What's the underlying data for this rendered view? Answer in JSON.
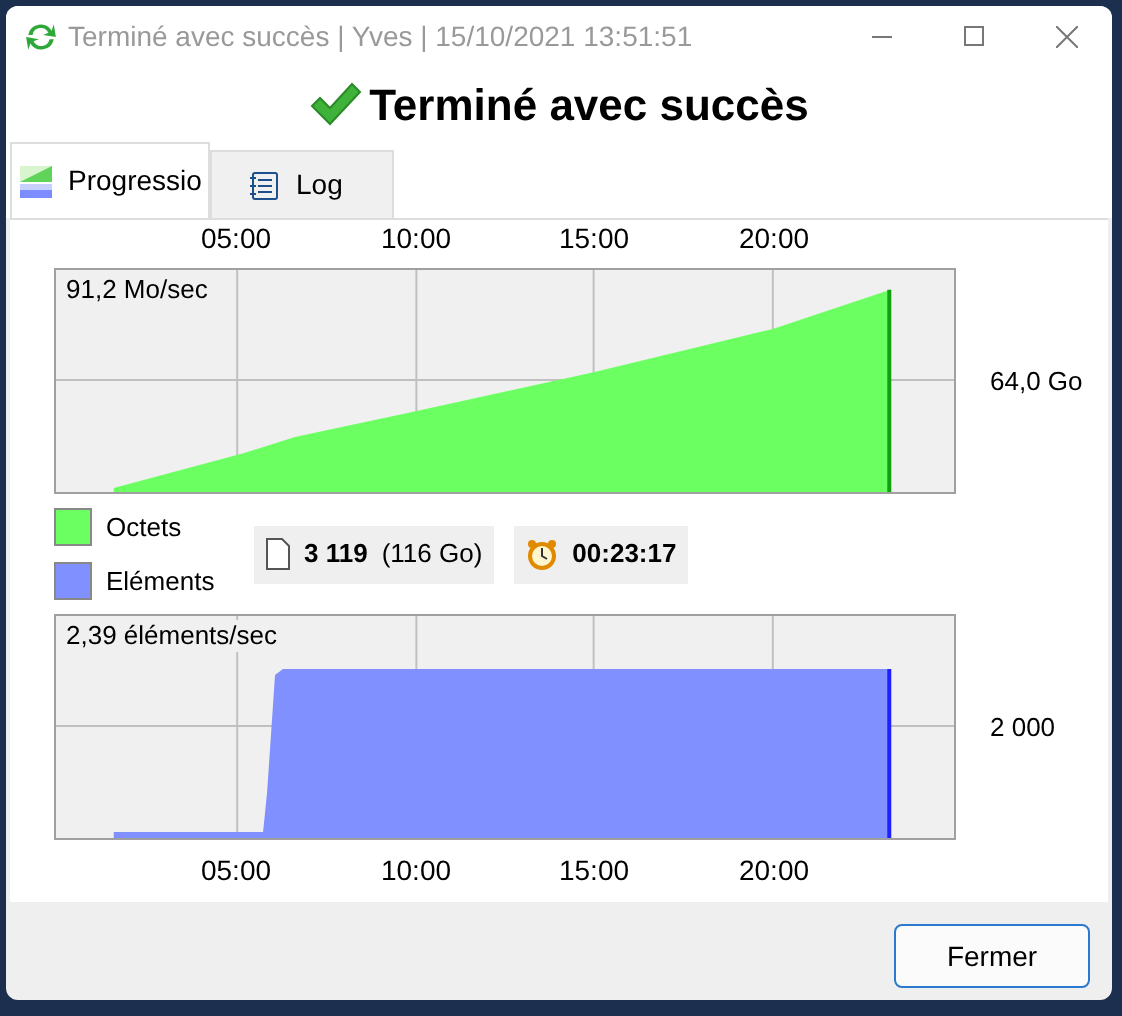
{
  "window": {
    "title": "Terminé avec succès | Yves | 15/10/2021 13:51:51"
  },
  "heading": "Terminé avec succès",
  "tabs": [
    {
      "label": "Progressio",
      "kind": "chart",
      "selected": true
    },
    {
      "label": "Log",
      "kind": "log",
      "selected": false
    }
  ],
  "chart_top": {
    "rate": "91,2 Mo/sec",
    "y_label": "64,0 Go",
    "x_ticks": [
      "05:00",
      "10:00",
      "15:00",
      "20:00"
    ]
  },
  "legend": [
    {
      "label": "Octets",
      "color": "#6cff62"
    },
    {
      "label": "Eléments",
      "color": "#8090ff"
    }
  ],
  "stats": [
    {
      "kind": "files",
      "value": "3 119",
      "detail": "(116 Go)"
    },
    {
      "kind": "time",
      "value": "00:23:17"
    }
  ],
  "chart_bottom": {
    "rate": "2,39 éléments/sec",
    "y_label": "2 000",
    "x_ticks": [
      "05:00",
      "10:00",
      "15:00",
      "20:00"
    ]
  },
  "buttons": [
    {
      "label": "Fermer"
    }
  ]
}
